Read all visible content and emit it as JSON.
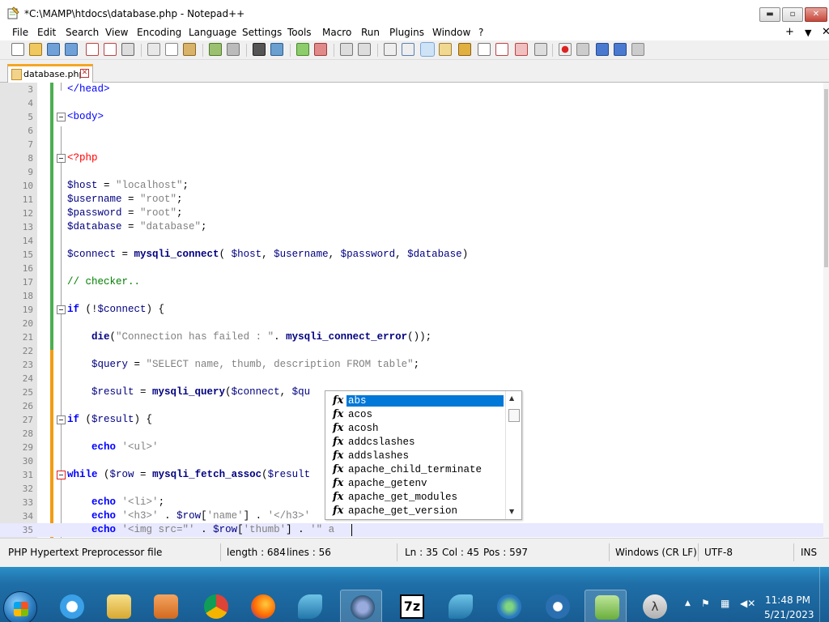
{
  "window": {
    "title": "*C:\\MAMP\\htdocs\\database.php - Notepad++",
    "minimize_label": "▬",
    "maximize_label": "▫",
    "close_label": "✕"
  },
  "menu": {
    "items": [
      "File",
      "Edit",
      "Search",
      "View",
      "Encoding",
      "Language",
      "Settings",
      "Tools",
      "Macro",
      "Run",
      "Plugins",
      "Window",
      "?"
    ],
    "right": [
      "+",
      "▼",
      "✕"
    ]
  },
  "tab": {
    "label": "database.php",
    "close": "✕"
  },
  "editor": {
    "lines": [
      {
        "n": "3",
        "tokens": [
          [
            "t-tag",
            "</head>"
          ]
        ]
      },
      {
        "n": "4",
        "tokens": []
      },
      {
        "n": "5",
        "tokens": [
          [
            "t-tag",
            "<body>"
          ]
        ]
      },
      {
        "n": "6",
        "tokens": []
      },
      {
        "n": "7",
        "tokens": []
      },
      {
        "n": "8",
        "tokens": [
          [
            "t-php",
            "<?php"
          ]
        ]
      },
      {
        "n": "9",
        "tokens": []
      },
      {
        "n": "10",
        "tokens": [
          [
            "t-var",
            "$host"
          ],
          [
            "t-plain",
            " = "
          ],
          [
            "t-str",
            "\"localhost\""
          ],
          [
            "t-plain",
            ";"
          ]
        ]
      },
      {
        "n": "11",
        "tokens": [
          [
            "t-var",
            "$username"
          ],
          [
            "t-plain",
            " = "
          ],
          [
            "t-str",
            "\"root\""
          ],
          [
            "t-plain",
            ";"
          ]
        ]
      },
      {
        "n": "12",
        "tokens": [
          [
            "t-var",
            "$password"
          ],
          [
            "t-plain",
            " = "
          ],
          [
            "t-str",
            "\"root\""
          ],
          [
            "t-plain",
            ";"
          ]
        ]
      },
      {
        "n": "13",
        "tokens": [
          [
            "t-var",
            "$database"
          ],
          [
            "t-plain",
            " = "
          ],
          [
            "t-str",
            "\"database\""
          ],
          [
            "t-plain",
            ";"
          ]
        ]
      },
      {
        "n": "14",
        "tokens": []
      },
      {
        "n": "15",
        "tokens": [
          [
            "t-var",
            "$connect"
          ],
          [
            "t-plain",
            " = "
          ],
          [
            "t-fn",
            "mysqli_connect"
          ],
          [
            "t-plain",
            "( "
          ],
          [
            "t-var",
            "$host"
          ],
          [
            "t-plain",
            ", "
          ],
          [
            "t-var",
            "$username"
          ],
          [
            "t-plain",
            ", "
          ],
          [
            "t-var",
            "$password"
          ],
          [
            "t-plain",
            ", "
          ],
          [
            "t-var",
            "$database"
          ],
          [
            "t-plain",
            ")"
          ]
        ]
      },
      {
        "n": "16",
        "tokens": []
      },
      {
        "n": "17",
        "tokens": [
          [
            "t-cmt",
            "// checker.."
          ]
        ]
      },
      {
        "n": "18",
        "tokens": []
      },
      {
        "n": "19",
        "tokens": [
          [
            "t-kw",
            "if"
          ],
          [
            "t-plain",
            " (!"
          ],
          [
            "t-var",
            "$connect"
          ],
          [
            "t-plain",
            ") {"
          ]
        ]
      },
      {
        "n": "20",
        "tokens": []
      },
      {
        "n": "21",
        "tokens": [
          [
            "t-plain",
            "    "
          ],
          [
            "t-fn",
            "die"
          ],
          [
            "t-plain",
            "("
          ],
          [
            "t-str",
            "\"Connection has failed : \""
          ],
          [
            "t-plain",
            ". "
          ],
          [
            "t-fn",
            "mysqli_connect_error"
          ],
          [
            "t-plain",
            "());"
          ]
        ]
      },
      {
        "n": "22",
        "tokens": []
      },
      {
        "n": "23",
        "tokens": [
          [
            "t-plain",
            "    "
          ],
          [
            "t-var",
            "$query"
          ],
          [
            "t-plain",
            " = "
          ],
          [
            "t-str",
            "\"SELECT name, thumb, description FROM table\""
          ],
          [
            "t-plain",
            ";"
          ]
        ]
      },
      {
        "n": "24",
        "tokens": []
      },
      {
        "n": "25",
        "tokens": [
          [
            "t-plain",
            "    "
          ],
          [
            "t-var",
            "$result"
          ],
          [
            "t-plain",
            " = "
          ],
          [
            "t-fn",
            "mysqli_query"
          ],
          [
            "t-plain",
            "("
          ],
          [
            "t-var",
            "$connect"
          ],
          [
            "t-plain",
            ", "
          ],
          [
            "t-var",
            "$qu"
          ]
        ]
      },
      {
        "n": "26",
        "tokens": []
      },
      {
        "n": "27",
        "tokens": [
          [
            "t-kw",
            "if"
          ],
          [
            "t-plain",
            " ("
          ],
          [
            "t-var",
            "$result"
          ],
          [
            "t-plain",
            ") {"
          ]
        ]
      },
      {
        "n": "28",
        "tokens": []
      },
      {
        "n": "29",
        "tokens": [
          [
            "t-plain",
            "    "
          ],
          [
            "t-kw",
            "echo"
          ],
          [
            "t-plain",
            " "
          ],
          [
            "t-str",
            "'<ul>'"
          ]
        ]
      },
      {
        "n": "30",
        "tokens": []
      },
      {
        "n": "31",
        "tokens": [
          [
            "t-kw",
            "while"
          ],
          [
            "t-plain",
            " ("
          ],
          [
            "t-var",
            "$row"
          ],
          [
            "t-plain",
            " = "
          ],
          [
            "t-fn",
            "mysqli_fetch_assoc"
          ],
          [
            "t-plain",
            "("
          ],
          [
            "t-var",
            "$result"
          ]
        ]
      },
      {
        "n": "32",
        "tokens": []
      },
      {
        "n": "33",
        "tokens": [
          [
            "t-plain",
            "    "
          ],
          [
            "t-kw",
            "echo"
          ],
          [
            "t-plain",
            " "
          ],
          [
            "t-str",
            "'<li>'"
          ],
          [
            "t-plain",
            ";"
          ]
        ]
      },
      {
        "n": "34",
        "tokens": [
          [
            "t-plain",
            "    "
          ],
          [
            "t-kw",
            "echo"
          ],
          [
            "t-plain",
            " "
          ],
          [
            "t-str",
            "'<h3>'"
          ],
          [
            "t-plain",
            " . "
          ],
          [
            "t-var",
            "$row"
          ],
          [
            "t-plain",
            "["
          ],
          [
            "t-str",
            "'name'"
          ],
          [
            "t-plain",
            "] . "
          ],
          [
            "t-str",
            "'</h3>'"
          ]
        ]
      },
      {
        "n": "35",
        "tokens": [
          [
            "t-plain",
            "    "
          ],
          [
            "t-kw",
            "echo"
          ],
          [
            "t-plain",
            " "
          ],
          [
            "t-str",
            "'<img src=\"'"
          ],
          [
            "t-plain",
            " . "
          ],
          [
            "t-var",
            "$row"
          ],
          [
            "t-plain",
            "["
          ],
          [
            "t-str",
            "'thumb'"
          ],
          [
            "t-plain",
            "] . "
          ],
          [
            "t-str",
            "'\" a"
          ]
        ]
      }
    ]
  },
  "autocomplete": {
    "icon": "fx",
    "items": [
      "abs",
      "acos",
      "acosh",
      "addcslashes",
      "addslashes",
      "apache_child_terminate",
      "apache_getenv",
      "apache_get_modules",
      "apache_get_version"
    ],
    "selected_index": 0
  },
  "status": {
    "language": "PHP Hypertext Preprocessor file",
    "length": "length : 684",
    "lines": "lines : 56",
    "ln": "Ln : 35",
    "col": "Col : 45",
    "pos": "Pos : 597",
    "eol": "Windows (CR LF)",
    "encoding": "UTF-8",
    "mode": "INS"
  },
  "taskbar": {
    "apps": [
      "internet-explorer",
      "file-explorer",
      "media-player",
      "chrome",
      "firefox",
      "mysql-workbench",
      "network-tool",
      "7zip",
      "mysql-workbench-2",
      "globe-tool",
      "remote-tool",
      "notepad-plus-plus",
      "lambda-tool"
    ],
    "clock_time": "11:48 PM",
    "clock_date": "5/21/2023"
  },
  "colors": {
    "tab_accent": "#f5a623",
    "selection": "#0078d7",
    "current_line": "#e8e8ff",
    "taskbar": "#1f6fa8"
  }
}
